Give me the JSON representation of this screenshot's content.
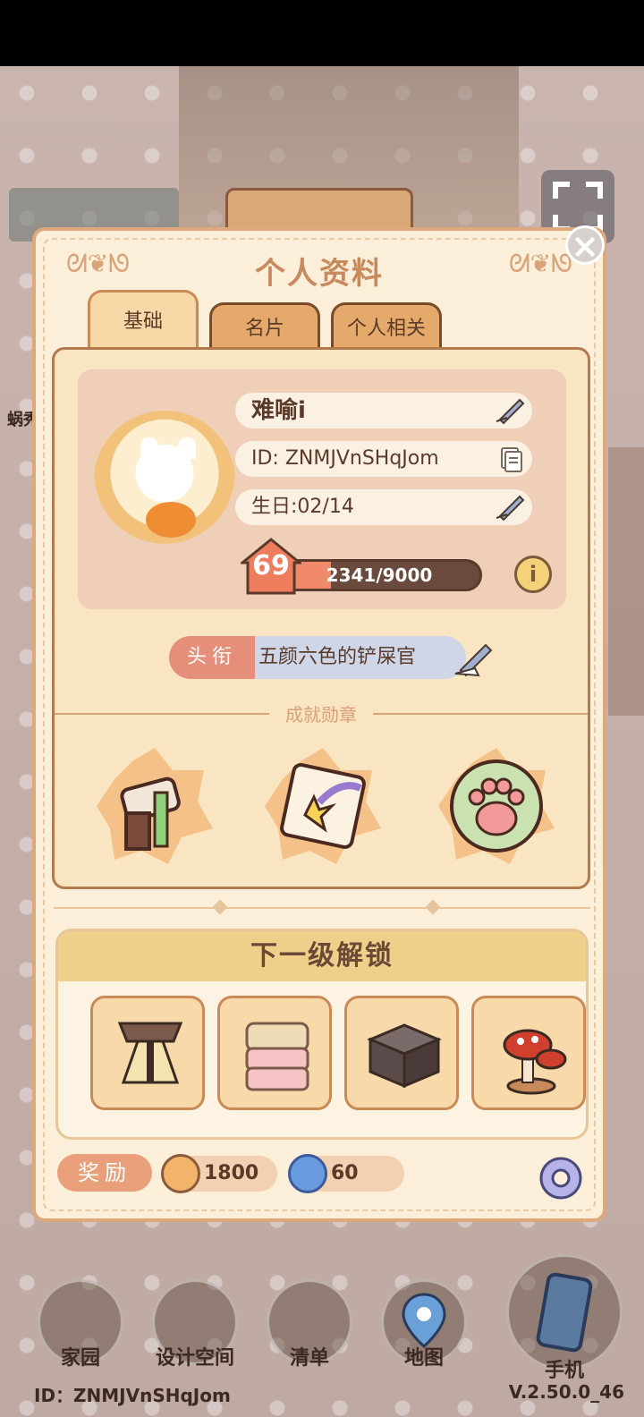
{
  "modal": {
    "title": "个人资料",
    "tabs": [
      {
        "label": "基础",
        "active": true
      },
      {
        "label": "名片",
        "active": false
      },
      {
        "label": "个人相关",
        "active": false
      }
    ]
  },
  "profile": {
    "name": "难喻i",
    "id": "ID: ZNMJVnSHqJom",
    "birthday": "生日:02/14",
    "level": "69",
    "xp": "2341/9000",
    "xp_fraction": 0.26
  },
  "title_row": {
    "label": "头衔",
    "value": "五颜六色的铲屎官"
  },
  "achievements": {
    "title": "成就勋章",
    "badges": [
      "paint-roller-badge",
      "shooting-star-scroll-badge",
      "paw-print-badge"
    ]
  },
  "unlock": {
    "title": "下一级解锁",
    "items": [
      "hourglass-stand-item",
      "pink-stacked-box-item",
      "dark-box-item",
      "mushroom-item"
    ]
  },
  "rewards": {
    "label": "奖励",
    "coins": "1800",
    "gems": "60"
  },
  "nav": {
    "items": [
      {
        "label": "家园"
      },
      {
        "label": "设计空间"
      },
      {
        "label": "清单"
      },
      {
        "label": "地图"
      },
      {
        "label": "手机"
      }
    ]
  },
  "footer": {
    "id": "ID：ZNMJVnSHqJom",
    "version": "V.2.50.0_46"
  },
  "background": {
    "side_label": "蜗秀"
  },
  "colors": {
    "modal_bg": "#fbefd9",
    "accent": "#c8895c",
    "xp_fill": "#f08a6a"
  }
}
